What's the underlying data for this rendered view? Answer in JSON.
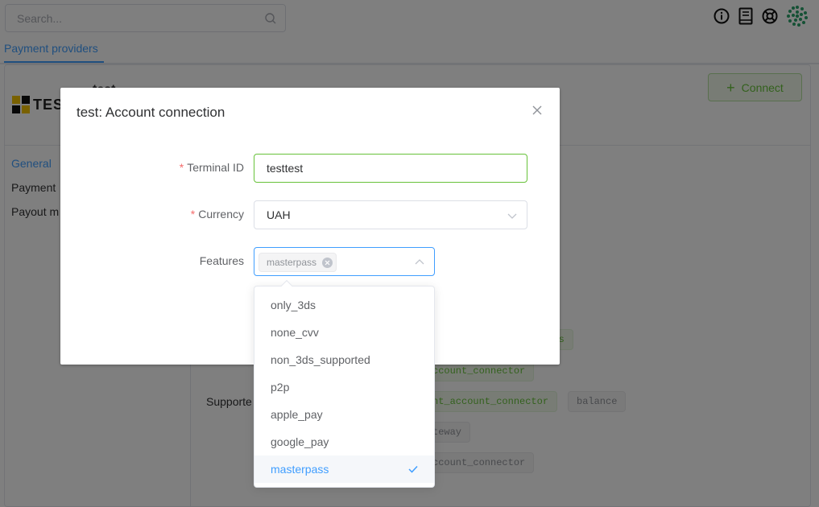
{
  "header": {
    "search_placeholder": "Search...",
    "icons": [
      "info-icon",
      "book-icon",
      "lifebuoy-icon",
      "avatar-icon"
    ]
  },
  "tabs": [
    {
      "label": "Payment providers",
      "active": true
    }
  ],
  "provider": {
    "logo_text": "TES",
    "name": "test",
    "connect_label": "Connect"
  },
  "side_nav": [
    {
      "label": "General",
      "active": true
    },
    {
      "label": "Payment"
    },
    {
      "label": "Payout m"
    }
  ],
  "background_section": {
    "supported_label": "Supporte",
    "tags": [
      {
        "text": "ents",
        "color": "green"
      },
      {
        "text": "ccount_connector",
        "color": "green"
      },
      {
        "text": "nt_account_connector",
        "color": "green"
      },
      {
        "text": "balance",
        "color": "grey"
      },
      {
        "text": "teway",
        "color": "grey"
      },
      {
        "text": "ccount_connector",
        "color": "grey"
      }
    ]
  },
  "dialog": {
    "title": "test: Account connection",
    "terminal": {
      "label": "Terminal ID",
      "value": "testtest",
      "required": true
    },
    "currency": {
      "label": "Currency",
      "value": "UAH",
      "required": true
    },
    "features": {
      "label": "Features",
      "selected": [
        "masterpass"
      ]
    }
  },
  "dropdown": {
    "options": [
      {
        "label": "only_3ds",
        "selected": false
      },
      {
        "label": "none_cvv",
        "selected": false
      },
      {
        "label": "non_3ds_supported",
        "selected": false
      },
      {
        "label": "p2p",
        "selected": false
      },
      {
        "label": "apple_pay",
        "selected": false
      },
      {
        "label": "google_pay",
        "selected": false
      },
      {
        "label": "masterpass",
        "selected": true
      }
    ]
  },
  "colors": {
    "primary": "#409eff",
    "success": "#67c23a",
    "danger": "#f56c6c",
    "overlay": "rgba(0,0,0,0.5)"
  }
}
